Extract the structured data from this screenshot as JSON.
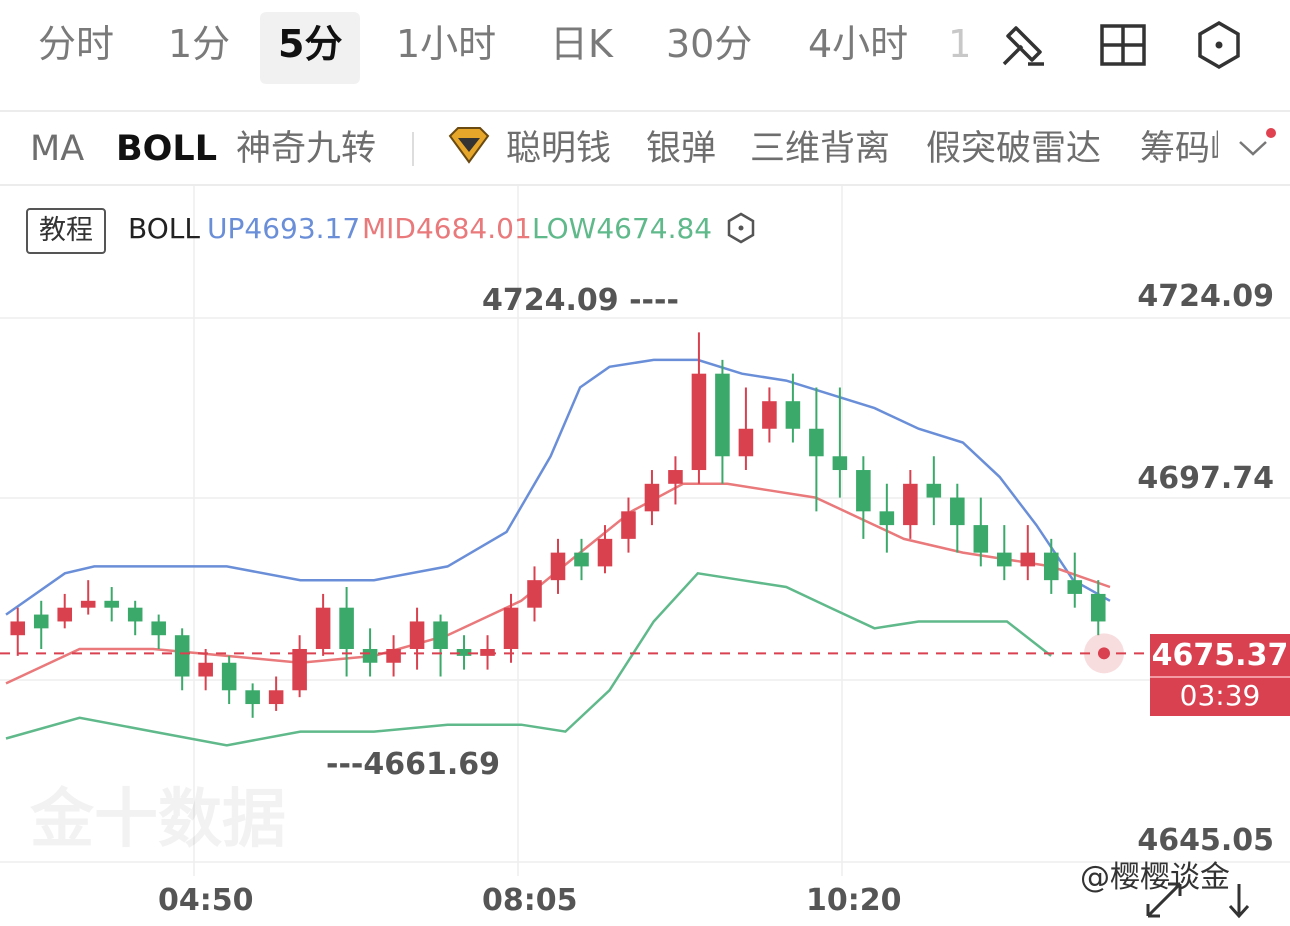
{
  "timeframe_tabs": [
    {
      "label": "分时",
      "active": false
    },
    {
      "label": "1分",
      "active": false
    },
    {
      "label": "5分",
      "active": true
    },
    {
      "label": "1小时",
      "active": false
    },
    {
      "label": "日K",
      "active": false
    },
    {
      "label": "30分",
      "active": false
    },
    {
      "label": "4小时",
      "active": false
    }
  ],
  "timeframe_tab_clipped": "1",
  "tool_icons": [
    "draw-icon",
    "layout-grid-icon",
    "settings-hex-icon"
  ],
  "indicators": [
    {
      "label": "MA",
      "active": false
    },
    {
      "label": "BOLL",
      "active": true
    },
    {
      "label": "神奇九转",
      "active": false
    },
    {
      "label": "聪明钱",
      "active": false,
      "icon": "diamond-icon"
    },
    {
      "label": "银弹",
      "active": false
    },
    {
      "label": "三维背离",
      "active": false
    },
    {
      "label": "假突破雷达",
      "active": false
    },
    {
      "label": "筹码峰",
      "active": false
    }
  ],
  "tutorial_label": "教程",
  "legend": {
    "name": "BOLL",
    "up": "UP4693.17",
    "mid": "MID4684.01",
    "low": "LOW4674.84"
  },
  "colors": {
    "up_line": "#6a8fd8",
    "mid_line": "#e9797b",
    "low_line": "#5fb98a",
    "candle_up": "#d9414f",
    "candle_down": "#3aa96a",
    "price_box": "#d94150"
  },
  "current_price": "4675.37",
  "countdown": "03:39",
  "y_axis_labels": [
    "4724.09",
    "4697.74",
    "4645.05"
  ],
  "x_axis_labels": [
    "04:50",
    "08:05",
    "10:20"
  ],
  "annotations": {
    "high": "4724.09",
    "low": "4661.69"
  },
  "watermark": "金十数据",
  "credit": "@樱樱谈金",
  "chart_data": {
    "type": "candlestick",
    "ylim": [
      4645.05,
      4724.09
    ],
    "x_ticks": [
      "04:50",
      "08:05",
      "10:20"
    ],
    "bands": {
      "up": [
        [
          0,
          4681
        ],
        [
          8,
          4687
        ],
        [
          12,
          4688
        ],
        [
          20,
          4688
        ],
        [
          30,
          4688
        ],
        [
          40,
          4686
        ],
        [
          50,
          4686
        ],
        [
          60,
          4688
        ],
        [
          68,
          4693
        ],
        [
          74,
          4704
        ],
        [
          78,
          4714
        ],
        [
          82,
          4717
        ],
        [
          88,
          4718
        ],
        [
          94,
          4718
        ],
        [
          100,
          4716
        ],
        [
          106,
          4715
        ],
        [
          112,
          4713
        ],
        [
          118,
          4711
        ],
        [
          124,
          4708
        ],
        [
          130,
          4706
        ],
        [
          135,
          4701
        ],
        [
          140,
          4694
        ],
        [
          145,
          4686
        ],
        [
          150,
          4683
        ]
      ],
      "mid": [
        [
          0,
          4671
        ],
        [
          10,
          4676
        ],
        [
          20,
          4676
        ],
        [
          30,
          4675
        ],
        [
          40,
          4674
        ],
        [
          50,
          4675
        ],
        [
          60,
          4678
        ],
        [
          70,
          4683
        ],
        [
          78,
          4690
        ],
        [
          85,
          4696
        ],
        [
          92,
          4700
        ],
        [
          98,
          4700
        ],
        [
          104,
          4699
        ],
        [
          110,
          4698
        ],
        [
          116,
          4695
        ],
        [
          122,
          4692
        ],
        [
          130,
          4690
        ],
        [
          136,
          4689
        ],
        [
          142,
          4688
        ],
        [
          150,
          4685
        ]
      ],
      "low": [
        [
          0,
          4663
        ],
        [
          10,
          4666
        ],
        [
          20,
          4664
        ],
        [
          30,
          4662
        ],
        [
          40,
          4664
        ],
        [
          50,
          4664
        ],
        [
          60,
          4665
        ],
        [
          70,
          4665
        ],
        [
          76,
          4664
        ],
        [
          82,
          4670
        ],
        [
          88,
          4680
        ],
        [
          94,
          4687
        ],
        [
          100,
          4686
        ],
        [
          106,
          4685
        ],
        [
          112,
          4682
        ],
        [
          118,
          4679
        ],
        [
          124,
          4680
        ],
        [
          130,
          4680
        ],
        [
          136,
          4680
        ],
        [
          142,
          4675
        ]
      ]
    },
    "candles": [
      [
        4678,
        4680,
        4682,
        4675
      ],
      [
        4681,
        4679,
        4683,
        4676
      ],
      [
        4680,
        4682,
        4684,
        4679
      ],
      [
        4682,
        4683,
        4686,
        4681
      ],
      [
        4683,
        4682,
        4685,
        4680
      ],
      [
        4682,
        4680,
        4683,
        4678
      ],
      [
        4680,
        4678,
        4681,
        4676
      ],
      [
        4678,
        4672,
        4679,
        4670
      ],
      [
        4672,
        4674,
        4676,
        4670
      ],
      [
        4674,
        4670,
        4675,
        4668
      ],
      [
        4670,
        4668,
        4671,
        4666
      ],
      [
        4668,
        4670,
        4672,
        4667
      ],
      [
        4670,
        4676,
        4678,
        4669
      ],
      [
        4676,
        4682,
        4684,
        4675
      ],
      [
        4682,
        4676,
        4685,
        4672
      ],
      [
        4676,
        4674,
        4679,
        4672
      ],
      [
        4674,
        4676,
        4678,
        4672
      ],
      [
        4676,
        4680,
        4682,
        4673
      ],
      [
        4680,
        4676,
        4681,
        4672
      ],
      [
        4676,
        4675,
        4678,
        4673
      ],
      [
        4675,
        4676,
        4678,
        4673
      ],
      [
        4676,
        4682,
        4684,
        4674
      ],
      [
        4682,
        4686,
        4688,
        4680
      ],
      [
        4686,
        4690,
        4692,
        4684
      ],
      [
        4690,
        4688,
        4692,
        4686
      ],
      [
        4688,
        4692,
        4694,
        4687
      ],
      [
        4692,
        4696,
        4698,
        4690
      ],
      [
        4696,
        4700,
        4702,
        4694
      ],
      [
        4700,
        4702,
        4704,
        4697
      ],
      [
        4702,
        4716,
        4722,
        4700
      ],
      [
        4716,
        4704,
        4718,
        4700
      ],
      [
        4704,
        4708,
        4714,
        4702
      ],
      [
        4708,
        4712,
        4714,
        4706
      ],
      [
        4712,
        4708,
        4716,
        4706
      ],
      [
        4708,
        4704,
        4714,
        4696
      ],
      [
        4704,
        4702,
        4714,
        4698
      ],
      [
        4702,
        4696,
        4704,
        4692
      ],
      [
        4696,
        4694,
        4700,
        4690
      ],
      [
        4694,
        4700,
        4702,
        4692
      ],
      [
        4700,
        4698,
        4704,
        4694
      ],
      [
        4698,
        4694,
        4700,
        4690
      ],
      [
        4694,
        4690,
        4698,
        4688
      ],
      [
        4690,
        4688,
        4694,
        4686
      ],
      [
        4688,
        4690,
        4694,
        4686
      ],
      [
        4690,
        4686,
        4692,
        4684
      ],
      [
        4686,
        4684,
        4690,
        4682
      ],
      [
        4684,
        4680,
        4686,
        4678
      ]
    ]
  }
}
